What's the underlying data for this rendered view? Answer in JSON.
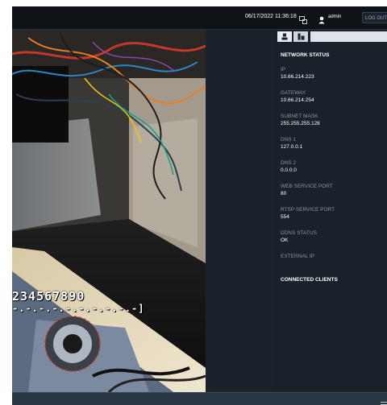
{
  "topbar": {
    "datetime": "06/17/2022 11:36:18",
    "layout_icon": "layout-icon",
    "user_icon": "user-icon",
    "username": "admin",
    "logout_label": "LOG OUT"
  },
  "video": {
    "osd_digits": "234567890",
    "osd_dashes": "-.-.-.-.-.-.-.-.-.-]"
  },
  "panel": {
    "tabs": [
      {
        "icon": "network-status-icon",
        "active": true
      },
      {
        "icon": "clients-icon",
        "active": false
      }
    ],
    "heading": "NETWORK STATUS",
    "fields": [
      {
        "label": "IP",
        "value": "10.66.214.223"
      },
      {
        "label": "GATEWAY",
        "value": "10.66.214.254"
      },
      {
        "label": "SUBNET MASK",
        "value": "255.255.255.128"
      },
      {
        "label": "DNS 1",
        "value": "127.0.0.1"
      },
      {
        "label": "DNS 2",
        "value": "0.0.0.0"
      },
      {
        "label": "WEB SERVICE PORT",
        "value": "80"
      },
      {
        "label": "RTSP SERVICE PORT",
        "value": "554"
      },
      {
        "label": "DDNS STATUS",
        "value": "OK"
      },
      {
        "label": "EXTERNAL IP",
        "value": ""
      }
    ],
    "connected_clients_heading": "CONNECTED CLIENTS"
  },
  "bottombar": {
    "menu_icon": "menu-icon"
  },
  "colors": {
    "background": "#1a212a",
    "topbar": "#0f1318",
    "label": "#8a96a3",
    "value": "#ffffff",
    "bottombar": "#2a3644"
  }
}
